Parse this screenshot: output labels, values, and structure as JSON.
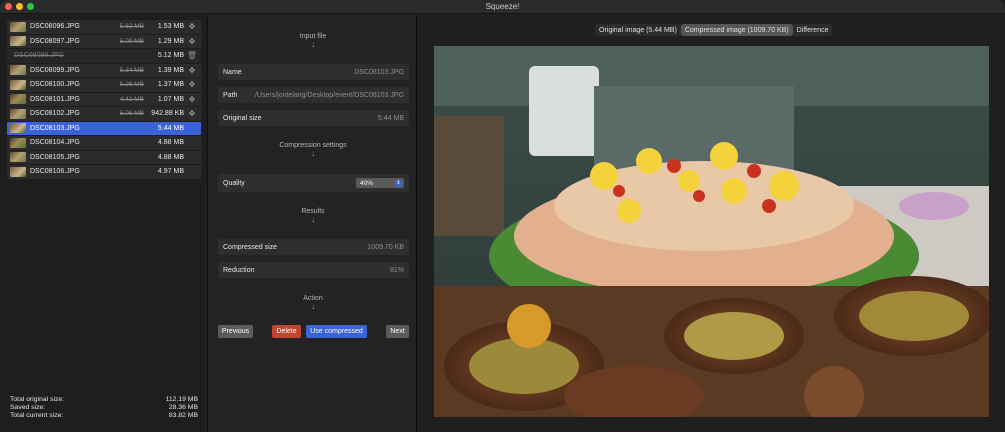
{
  "app": {
    "title": "Squeeze!"
  },
  "files": [
    {
      "name": "DSC08096.JPG",
      "original": "5.62 MB",
      "current": "1.53 MB",
      "action_icon": "move-icon",
      "state": "compressed"
    },
    {
      "name": "DSC08097.JPG",
      "original": "5.09 MB",
      "current": "1.29 MB",
      "action_icon": "move-icon",
      "state": "compressed"
    },
    {
      "name": "DSC08098.JPG",
      "original": "",
      "current": "5.12 MB",
      "action_icon": "trash-icon",
      "state": "deleted"
    },
    {
      "name": "DSC08099.JPG",
      "original": "5.34 MB",
      "current": "1.39 MB",
      "action_icon": "move-icon",
      "state": "compressed"
    },
    {
      "name": "DSC08100.JPG",
      "original": "5.28 MB",
      "current": "1.37 MB",
      "action_icon": "move-icon",
      "state": "compressed"
    },
    {
      "name": "DSC08101.JPG",
      "original": "4.41 MB",
      "current": "1.07 MB",
      "action_icon": "move-icon",
      "state": "compressed"
    },
    {
      "name": "DSC08102.JPG",
      "original": "5.06 MB",
      "current": "942.88 KB",
      "action_icon": "move-icon",
      "state": "compressed"
    },
    {
      "name": "DSC08103.JPG",
      "original": "",
      "current": "5.44 MB",
      "action_icon": "",
      "state": "selected"
    },
    {
      "name": "DSC08104.JPG",
      "original": "",
      "current": "4.88 MB",
      "action_icon": "",
      "state": "normal"
    },
    {
      "name": "DSC08105.JPG",
      "original": "",
      "current": "4.88 MB",
      "action_icon": "",
      "state": "normal"
    },
    {
      "name": "DSC08106.JPG",
      "original": "",
      "current": "4.97 MB",
      "action_icon": "",
      "state": "normal"
    }
  ],
  "totals": {
    "original_label": "Total original size:",
    "original_value": "112.19 MB",
    "saved_label": "Saved size:",
    "saved_value": "28.36 MB",
    "current_label": "Total current size:",
    "current_value": "83.82 MB"
  },
  "input_file": {
    "heading": "Input file",
    "name_label": "Name",
    "name_value": "DSC08103.JPG",
    "path_label": "Path",
    "path_value": "/Users/jontelang/Desktop/event/DSC08103.JPG",
    "size_label": "Original size",
    "size_value": "5.44 MB"
  },
  "compression": {
    "heading": "Compression settings",
    "quality_label": "Quality",
    "quality_value": "40%"
  },
  "results": {
    "heading": "Results",
    "compressed_label": "Compressed size",
    "compressed_value": "1009.70 KB",
    "reduction_label": "Reduction",
    "reduction_value": "81%"
  },
  "action": {
    "heading": "Action",
    "previous": "Previous",
    "delete": "Delete",
    "use_compressed": "Use compressed",
    "next": "Next"
  },
  "view_tabs": {
    "original": "Original image (5.44 MB)",
    "compressed": "Compressed image (1009.70 KB)",
    "difference": "Difference",
    "selected": "compressed"
  },
  "colors": {
    "accent": "#3a63d8",
    "danger": "#c2452f"
  }
}
